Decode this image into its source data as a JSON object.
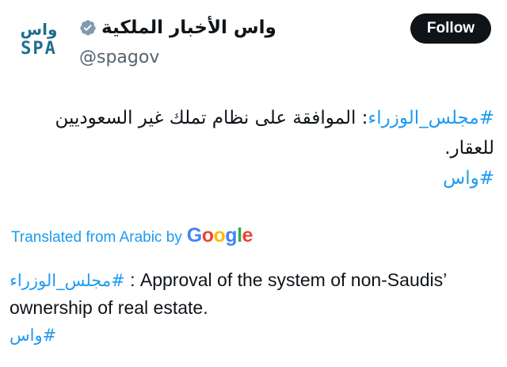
{
  "account": {
    "logo_text_top": "واس",
    "logo_text_bottom": "SPA",
    "display_name": "واس الأخبار الملكية",
    "handle": "@spagov"
  },
  "actions": {
    "follow_label": "Follow"
  },
  "post": {
    "hashtag_cabinet": "#مجلس_الوزراء",
    "body_text": ": الموافقة على نظام تملك غير السعوديين للعقار.",
    "hashtag_spa": "#واس"
  },
  "translation": {
    "prefix": "Translated from Arabic by",
    "provider_letters": [
      "G",
      "o",
      "o",
      "g",
      "l",
      "e"
    ],
    "hashtag_cabinet": "#مجلس_الوزراء",
    "body_text": " : Approval of the system of non-Saudis’ ownership of real estate.",
    "hashtag_spa": "#واس"
  },
  "colors": {
    "link": "#1d9bf0",
    "verified": "#829aab",
    "follow_bg": "#0f1419",
    "logo": "#1f6f8b"
  }
}
